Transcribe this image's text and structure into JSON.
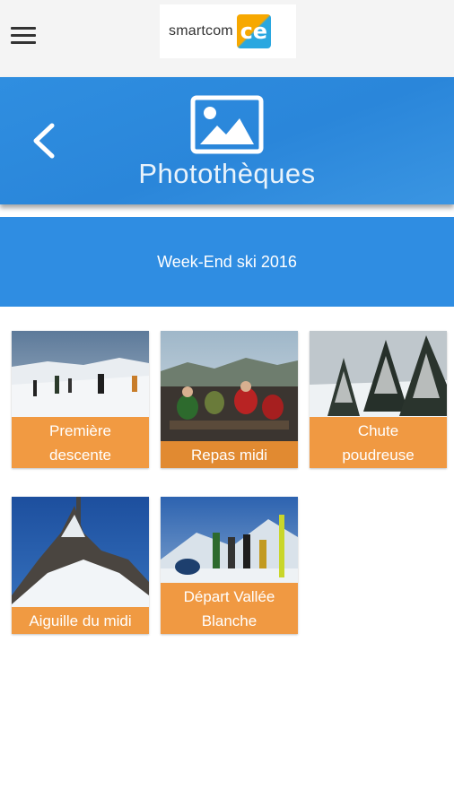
{
  "header": {
    "menu_icon": "hamburger-menu-icon",
    "logo_text": "smartcom",
    "logo_badge": "ce"
  },
  "hero": {
    "back_icon": "chevron-left-icon",
    "section_icon": "photo-icon",
    "title": "Photothèques"
  },
  "album": {
    "title": "Week-End ski 2016"
  },
  "photos": [
    {
      "line1": "Première",
      "line2": "descente"
    },
    {
      "line1": "Repas midi",
      "line2": ""
    },
    {
      "line1": "Chute",
      "line2": "poudreuse"
    },
    {
      "line1": "Aiguille du midi",
      "line2": ""
    },
    {
      "line1": "Départ Vallée",
      "line2": "Blanche"
    }
  ],
  "colors": {
    "primary_blue": "#2f8de2",
    "label_orange": "#f09132"
  }
}
